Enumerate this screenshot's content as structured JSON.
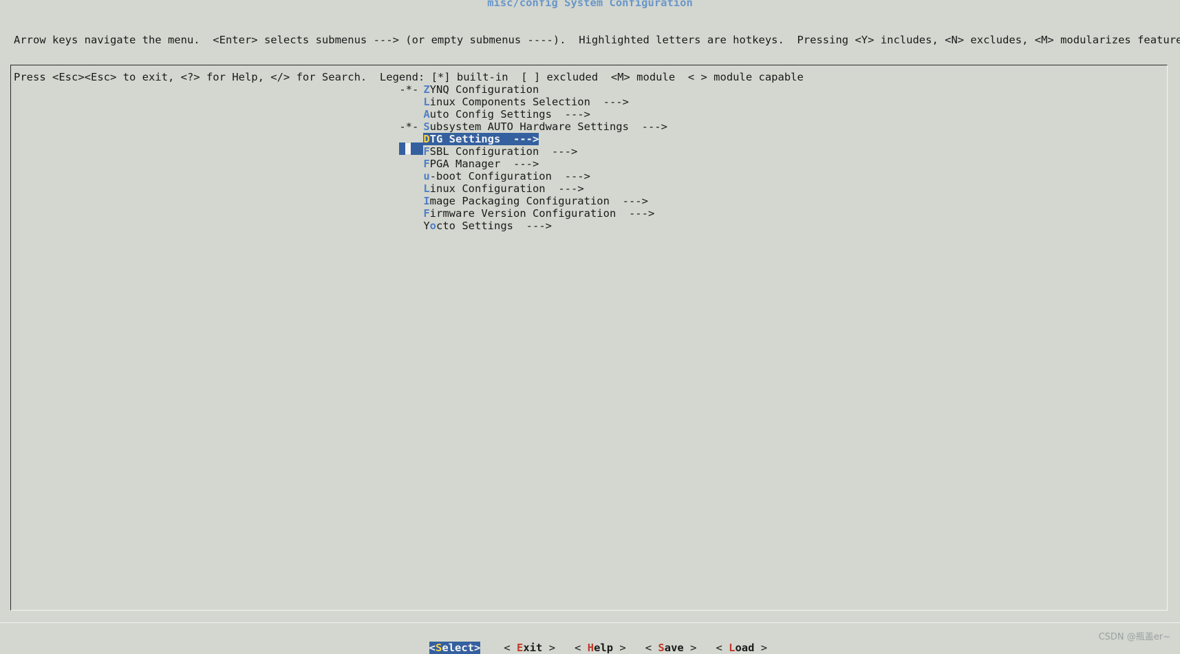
{
  "title": "misc/config System Configuration",
  "help_lines": [
    "Arrow keys navigate the menu.  <Enter> selects submenus ---> (or empty submenus ----).  Highlighted letters are hotkeys.  Pressing <Y> includes, <N> excludes, <M> modularizes features.",
    "Press <Esc><Esc> to exit, <?> for Help, </> for Search.  Legend: [*] built-in  [ ] excluded  <M> module  < > module capable"
  ],
  "menu": [
    {
      "mark": "-*-",
      "hotkey": "Z",
      "rest": "YNQ Configuration",
      "arrow": ""
    },
    {
      "mark": "",
      "hotkey": "L",
      "rest": "inux Components Selection",
      "arrow": "  --->"
    },
    {
      "mark": "",
      "hotkey": "A",
      "rest": "uto Config Settings",
      "arrow": "  --->"
    },
    {
      "mark": "-*-",
      "hotkey": "S",
      "rest": "ubsystem AUTO Hardware Settings",
      "arrow": "  --->"
    },
    {
      "mark": "",
      "hotkey": "D",
      "rest": "TG Settings",
      "arrow": "  --->",
      "selected": true
    },
    {
      "mark": "",
      "hotkey": "F",
      "rest": "SBL Configuration",
      "arrow": "  --->"
    },
    {
      "mark": "",
      "hotkey": "F",
      "rest": "PGA Manager",
      "arrow": "  --->"
    },
    {
      "mark": "",
      "hotkey": "u",
      "rest": "-boot Configuration",
      "arrow": "  --->"
    },
    {
      "mark": "",
      "hotkey": "L",
      "rest": "inux Configuration",
      "arrow": "  --->"
    },
    {
      "mark": "",
      "hotkey": "I",
      "rest": "mage Packaging Configuration",
      "arrow": "  --->"
    },
    {
      "mark": "",
      "hotkey": "F",
      "rest": "irmware Version Configuration",
      "arrow": "  --->"
    },
    {
      "mark": "",
      "pre": "Y",
      "hotkey": "o",
      "rest": "cto Settings",
      "arrow": "  --->"
    }
  ],
  "buttons": [
    {
      "open": "<",
      "hotkey": "S",
      "rest": "elect",
      "close": ">",
      "active": true
    },
    {
      "open": "< ",
      "hotkey": "E",
      "rest": "xit",
      "close": " >"
    },
    {
      "open": "< ",
      "hotkey": "H",
      "rest": "elp",
      "close": " >"
    },
    {
      "open": "< ",
      "hotkey": "S",
      "rest": "ave",
      "close": " >"
    },
    {
      "open": "< ",
      "hotkey": "L",
      "rest": "oad",
      "close": " >"
    }
  ],
  "watermark": "CSDN @瓶盖er~"
}
